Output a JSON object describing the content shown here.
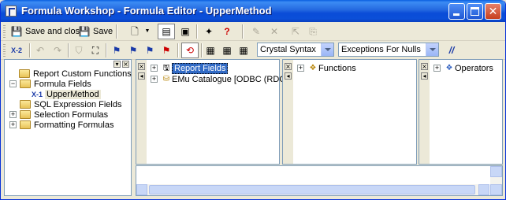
{
  "window": {
    "title": "Formula Workshop - Formula Editor - UpperMethod",
    "controls": {
      "minimize": "_",
      "maximize": "□",
      "close": "✕"
    }
  },
  "toolbar1": {
    "save_and_close_label": "Save and close",
    "save_label": "Save",
    "help_glyph": "?"
  },
  "toolbar2": {
    "x2_label": "X-2",
    "syntax_select": "Crystal Syntax",
    "nulls_select": "Exceptions For Nulls",
    "comment_label": "//"
  },
  "workshop_tree": {
    "items": [
      {
        "label": "Report Custom Functions",
        "level": 1,
        "expander": "",
        "icon": "function-folder-icon"
      },
      {
        "label": "Formula Fields",
        "level": 0,
        "expander": "−",
        "icon": "folder-icon"
      },
      {
        "label": "UpperMethod",
        "level": 1,
        "expander": "",
        "icon": "formula-icon",
        "icon_text": "X-1",
        "selected": false
      },
      {
        "label": "SQL Expression Fields",
        "level": 0,
        "expander": "",
        "icon": "folder-icon"
      },
      {
        "label": "Selection Formulas",
        "level": 0,
        "expander": "+",
        "icon": "folder-icon"
      },
      {
        "label": "Formatting Formulas",
        "level": 0,
        "expander": "+",
        "icon": "folder-icon"
      }
    ]
  },
  "fields_pane": {
    "items": [
      {
        "label": "Report Fields",
        "expander": "+",
        "selected": true
      },
      {
        "label": "EMu Catalogue [ODBC (RDO)]",
        "expander": "+",
        "selected": false
      }
    ]
  },
  "functions_pane": {
    "items": [
      {
        "label": "Functions",
        "expander": "+"
      }
    ]
  },
  "operators_pane": {
    "items": [
      {
        "label": "Operators",
        "expander": "+"
      }
    ]
  },
  "colors": {
    "titlebar": "#0a4cd8",
    "selection": "#316ac5",
    "chrome": "#ece9d8"
  }
}
